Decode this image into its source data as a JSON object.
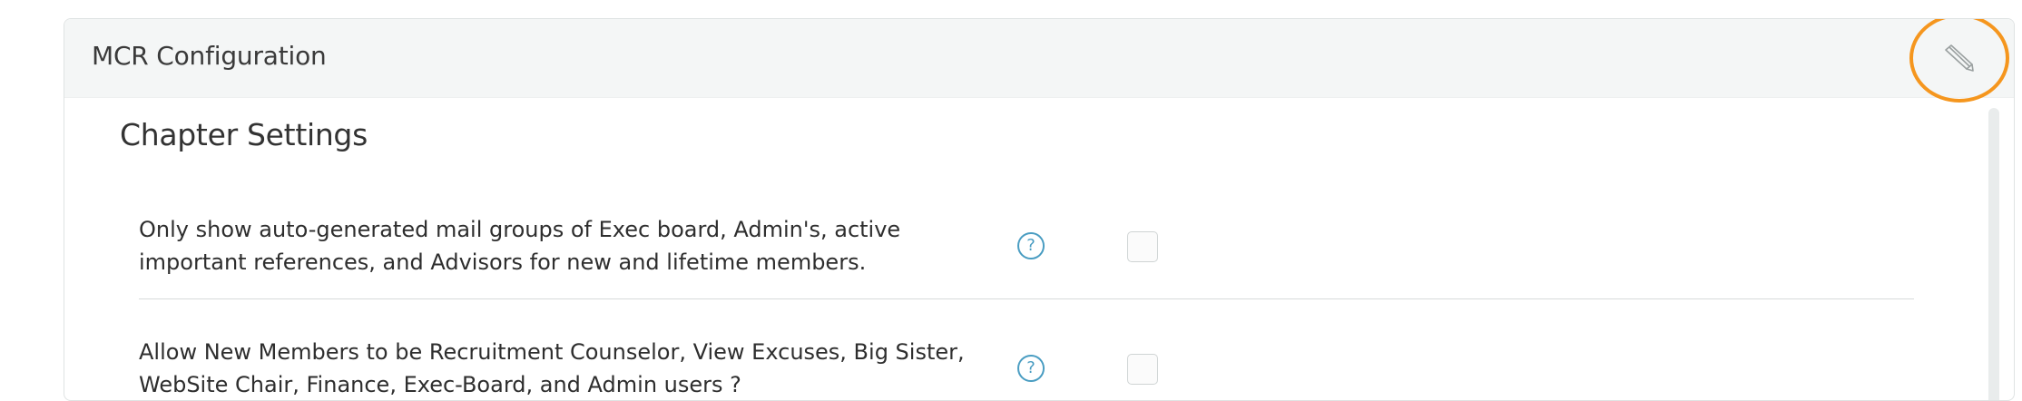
{
  "panel": {
    "title": "MCR Configuration",
    "edit_icon": "pencil-icon",
    "accent_color": "#f5961e"
  },
  "section": {
    "title": "Chapter Settings"
  },
  "settings": [
    {
      "text": "Only show auto-generated mail groups of Exec board, Admin's, active important references, and Advisors for new and lifetime members.",
      "help_symbol": "?",
      "checked": false
    },
    {
      "text": "Allow New Members to be Recruitment Counselor, View Excuses, Big Sister, WebSite Chair, Finance, Exec-Board, and Admin users ?",
      "help_symbol": "?",
      "checked": false
    }
  ]
}
